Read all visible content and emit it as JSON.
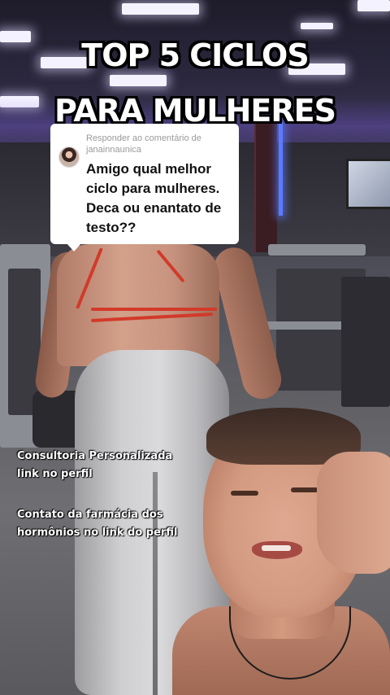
{
  "headline": {
    "line1": "TOP 5 CICLOS",
    "line2": "PARA MULHERES"
  },
  "reply_card": {
    "prefix": "Responder ao comentário de",
    "username": "janainnaunica",
    "avatar_icon": "user-avatar-icon",
    "comment_lines": [
      "Amigo qual melhor",
      "ciclo para mulheres.",
      "Deca ou enantato de",
      "testo??"
    ]
  },
  "captions": {
    "consult": [
      "Consultoria Personalizada",
      "link no perfil"
    ],
    "pharmacy": [
      "Contato da farmácia dos",
      "hormônios no link do perfil"
    ]
  },
  "colors": {
    "headline_text": "#ffffff",
    "headline_stroke": "#000000",
    "card_background": "#ffffff",
    "card_meta_text": "#9a9a9a"
  }
}
